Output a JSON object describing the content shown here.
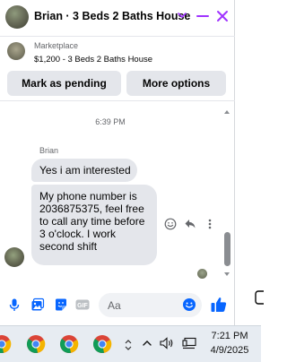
{
  "header": {
    "title": "Brian · 3 Beds 2 Baths House",
    "accent_color": "#a033ff"
  },
  "listing": {
    "source": "Marketplace",
    "price_title": "$1,200 - 3 Beds 2 Baths House",
    "mark_pending_label": "Mark as pending",
    "more_options_label": "More options"
  },
  "messages": {
    "timestamp": "6:39 PM",
    "sender": "Brian",
    "items": [
      "Yes i am interested",
      "My phone number is 2036875375, feel free to call any time before 3 o'clock. I work second shift"
    ],
    "bubble_color": "#e4e6eb"
  },
  "composer": {
    "placeholder": "Aa",
    "icons": [
      "mic-icon",
      "photo-icon",
      "sticker-icon",
      "gif-icon",
      "emoji-icon",
      "like-icon"
    ],
    "icon_color": "#0866ff"
  },
  "taskbar": {
    "apps": [
      "chrome-icon",
      "chrome-icon",
      "chrome-icon",
      "chrome-icon"
    ],
    "time": "7:21 PM",
    "date": "4/9/2025"
  }
}
